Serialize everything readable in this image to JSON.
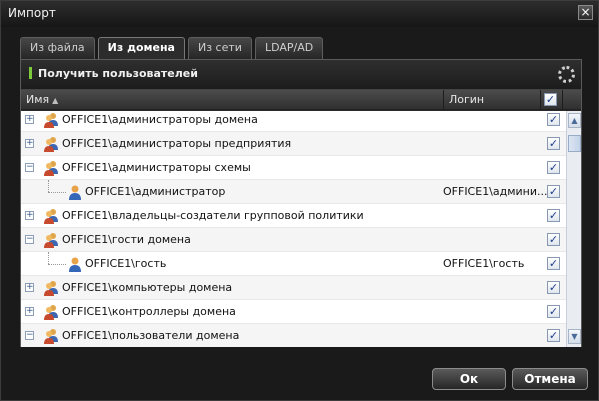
{
  "window": {
    "title": "Импорт",
    "close_glyph": "×"
  },
  "tabs": [
    {
      "label": "Из файла",
      "active": false
    },
    {
      "label": "Из домена",
      "active": true
    },
    {
      "label": "Из сети",
      "active": false
    },
    {
      "label": "LDAP/AD",
      "active": false
    }
  ],
  "toolbar": {
    "get_users_label": "Получить пользователей",
    "settings_icon": "gear-icon",
    "status_color": "#7ec83b"
  },
  "table": {
    "columns": {
      "name": "Имя",
      "login": "Логин"
    },
    "header_checked": true,
    "rows": [
      {
        "type": "group",
        "expander": "+",
        "name": "OFFICE1\\администраторы домена",
        "login": "",
        "checked": true
      },
      {
        "type": "group",
        "expander": "+",
        "name": "OFFICE1\\администраторы предприятия",
        "login": "",
        "checked": true
      },
      {
        "type": "group",
        "expander": "−",
        "name": "OFFICE1\\администраторы схемы",
        "login": "",
        "checked": true
      },
      {
        "type": "user",
        "expander": "",
        "name": "OFFICE1\\администратор",
        "login": "OFFICE1\\админи...",
        "checked": true
      },
      {
        "type": "group",
        "expander": "+",
        "name": "OFFICE1\\владельцы-создатели групповой политики",
        "login": "",
        "checked": true
      },
      {
        "type": "group",
        "expander": "−",
        "name": "OFFICE1\\гости домена",
        "login": "",
        "checked": true
      },
      {
        "type": "user",
        "expander": "",
        "name": "OFFICE1\\гость",
        "login": "OFFICE1\\гость",
        "checked": true
      },
      {
        "type": "group",
        "expander": "+",
        "name": "OFFICE1\\компьютеры домена",
        "login": "",
        "checked": true
      },
      {
        "type": "group",
        "expander": "+",
        "name": "OFFICE1\\контроллеры домена",
        "login": "",
        "checked": true
      },
      {
        "type": "group",
        "expander": "−",
        "name": "OFFICE1\\пользователи домена",
        "login": "",
        "checked": true
      }
    ]
  },
  "buttons": {
    "ok": "Ок",
    "cancel": "Отмена"
  }
}
